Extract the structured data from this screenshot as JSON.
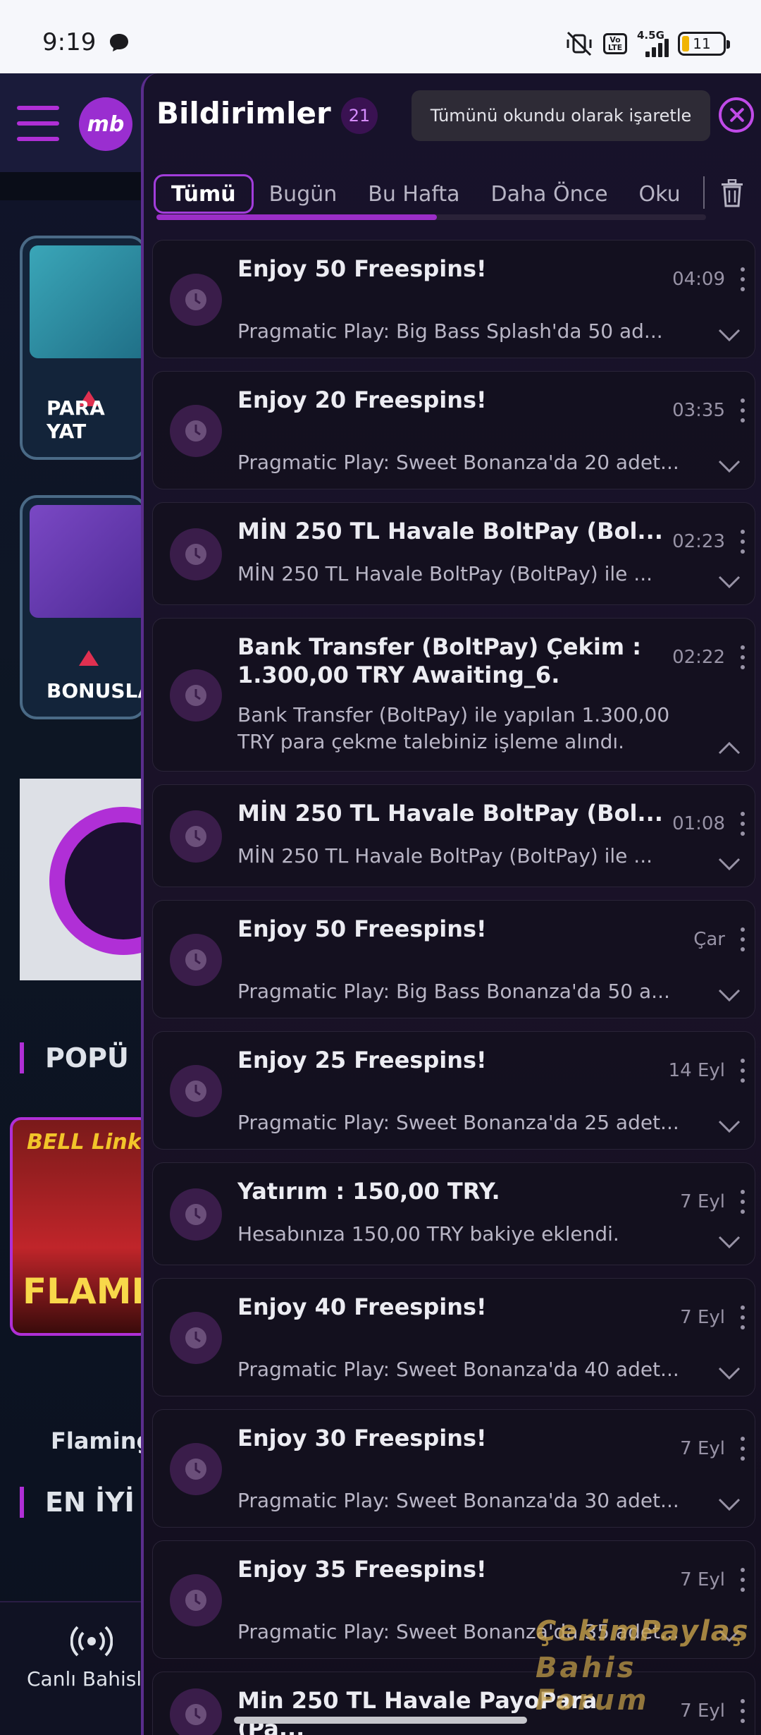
{
  "status_bar": {
    "time": "9:19",
    "network_label": "4.5G",
    "volte_label": "Vo LTE",
    "battery": "11"
  },
  "background": {
    "tile_deposit_label": "PARA YAT",
    "tile_bonus_label": "BONUSLA",
    "section_popular": "POPÜ",
    "game_title_top": "BELL Link",
    "game_title_bottom": "FLAMI",
    "game_name": "Flaming",
    "section_best": "EN İYİ",
    "bottom_nav_live": "Canlı Bahisl"
  },
  "panel": {
    "title": "Bildirimler",
    "count": "21",
    "mark_all_read": "Tümünü okundu olarak işaretle",
    "tabs": [
      {
        "label": "Tümü",
        "active": true
      },
      {
        "label": "Bugün",
        "active": false
      },
      {
        "label": "Bu Hafta",
        "active": false
      },
      {
        "label": "Daha Önce",
        "active": false
      },
      {
        "label": "Oku",
        "active": false
      }
    ],
    "tab_scroll_progress": 0.51
  },
  "notifications": [
    {
      "title": "Enjoy 50 Freespins!",
      "time": "04:09",
      "body": "Pragmatic Play: Big Bass Splash'da 50 ad...",
      "expanded": false
    },
    {
      "title": "Enjoy 20 Freespins!",
      "time": "03:35",
      "body": "Pragmatic Play: Sweet Bonanza'da 20 adet...",
      "expanded": false
    },
    {
      "title": "MİN 250 TL Havale BoltPay (Bol...",
      "time": "02:23",
      "body": "MİN 250 TL Havale BoltPay (BoltPay) ile ...",
      "expanded": false
    },
    {
      "title": "Bank Transfer (BoltPay) Çekim : 1.300,00 TRY Awaiting_6.",
      "time": "02:22",
      "body": "Bank Transfer (BoltPay) ile yapılan 1.300,00 TRY para çekme talebiniz işleme alındı.",
      "expanded": true
    },
    {
      "title": "MİN 250 TL Havale BoltPay (Bol...",
      "time": "01:08",
      "body": "MİN 250 TL Havale BoltPay (BoltPay) ile ...",
      "expanded": false
    },
    {
      "title": "Enjoy 50 Freespins!",
      "time": "Çar",
      "body": "Pragmatic Play: Big Bass Bonanza'da 50 a...",
      "expanded": false
    },
    {
      "title": "Enjoy 25 Freespins!",
      "time": "14 Eyl",
      "body": "Pragmatic Play: Sweet Bonanza'da 25 adet...",
      "expanded": false
    },
    {
      "title": "Yatırım : 150,00 TRY.",
      "time": "7 Eyl",
      "body": "Hesabınıza 150,00 TRY bakiye eklendi.",
      "expanded": false
    },
    {
      "title": "Enjoy 40 Freespins!",
      "time": "7 Eyl",
      "body": "Pragmatic Play: Sweet Bonanza'da 40 adet...",
      "expanded": false
    },
    {
      "title": "Enjoy 30 Freespins!",
      "time": "7 Eyl",
      "body": "Pragmatic Play: Sweet Bonanza'da 30 adet...",
      "expanded": false
    },
    {
      "title": "Enjoy 35 Freespins!",
      "time": "7 Eyl",
      "body": "Pragmatic Play: Sweet Bonanza'da 35 adet...",
      "expanded": false
    },
    {
      "title": "Min 250 TL Havale PayoPara (Pa...",
      "time": "7 Eyl",
      "body": "",
      "expanded": false
    }
  ],
  "watermark": {
    "line1": "ÇekimPaylaş",
    "line2": "Bahis Forum"
  },
  "colors": {
    "accent": "#a23ddb",
    "panel_bg": "#17122a",
    "status_bar_bg": "#f6f7fb"
  }
}
